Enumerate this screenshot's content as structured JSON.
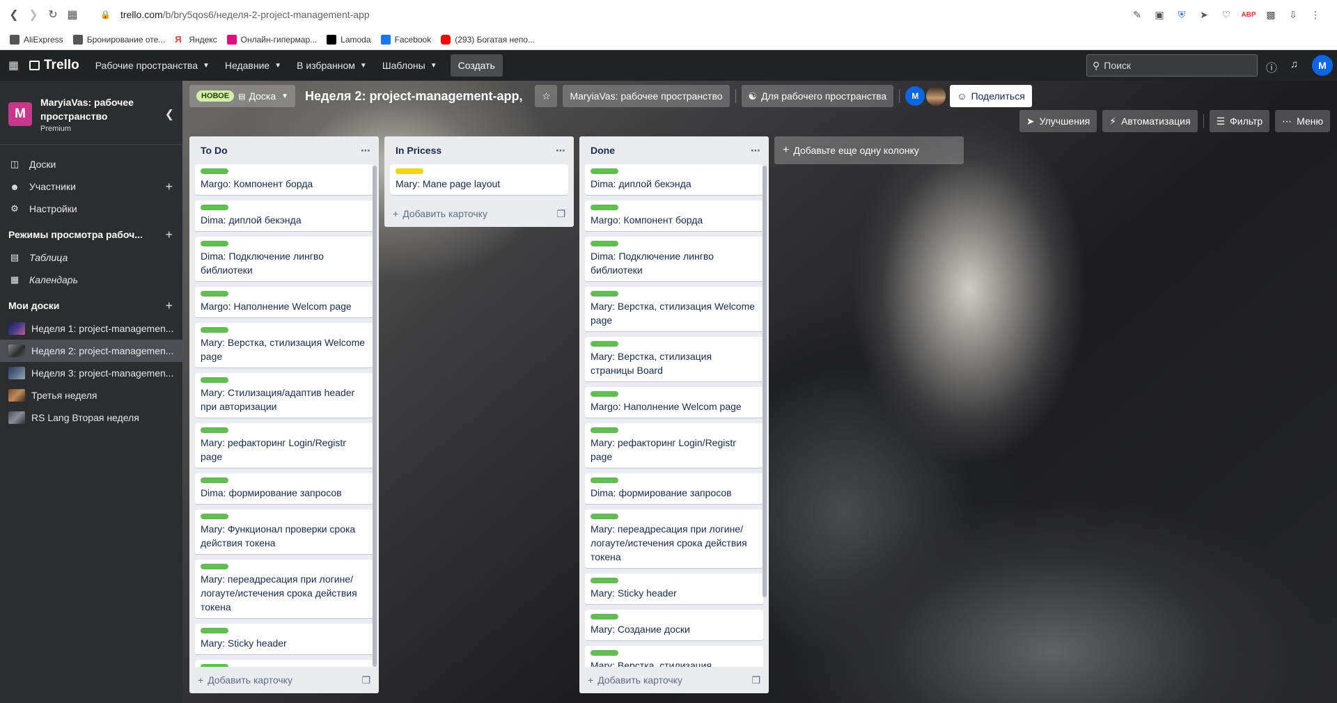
{
  "browser": {
    "url_domain": "trello.com",
    "url_path": "/b/bry5qos6/неделя-2-project-management-app",
    "bookmarks": [
      "AliExpress",
      "Бронирование оте...",
      "Яндекс",
      "Онлайн-гипермар...",
      "Lamoda",
      "Facebook",
      "(293) Богатая непо..."
    ]
  },
  "topnav": {
    "logo": "Trello",
    "menus": [
      "Рабочие пространства",
      "Недавние",
      "В избранном",
      "Шаблоны"
    ],
    "create": "Создать",
    "search_placeholder": "Поиск",
    "avatar": "M"
  },
  "sidebar": {
    "ws_initial": "M",
    "ws_name": "MaryiaVas: рабочее пространство",
    "ws_plan": "Premium",
    "items": [
      "Доски",
      "Участники",
      "Настройки"
    ],
    "views_header": "Режимы просмотра рабоч...",
    "views": [
      "Таблица",
      "Календарь"
    ],
    "boards_header": "Мои доски",
    "boards": [
      "Неделя 1: project-managemen...",
      "Неделя 2: project-managemen...",
      "Неделя 3: project-managemen...",
      "Третья неделя",
      "RS Lang Вторая неделя"
    ]
  },
  "board": {
    "new_badge": "НОВОЕ",
    "view": "Доска",
    "title": "Неделя 2: project-management-app,",
    "workspace": "MaryiaVas: рабочее пространство",
    "visibility": "Для рабочего пространства",
    "member": "M",
    "share": "Поделиться",
    "powerups": "Улучшения",
    "automation": "Автоматизация",
    "filter": "Фильтр",
    "menu": "Меню",
    "add_list": "Добавьте еще одну колонку",
    "add_card": "Добавить карточку"
  },
  "lists": [
    {
      "title": "To Do",
      "cards": [
        "Margo: Компонент борда",
        "Dima: диплой бекэнда",
        "Dima: Подключение лингво библиотеки",
        "Margo: Наполнение Welcom page",
        "Mary: Верстка, стилизация Welcome page",
        "Mary: Стилизация/адаптив header при авторизации",
        "Mary: рефакторинг Login/Registr page",
        "Dima: формирование запросов",
        "Mary: Функционал проверки срока действия токена",
        "Mary: переадресация при логине/логауте/истечения срока действия токена",
        "Mary: Sticky header"
      ]
    },
    {
      "title": "In Pricess",
      "cards": [
        "Mary: Mane page layout"
      ]
    },
    {
      "title": "Done",
      "cards": [
        "Dima: диплой бекэнда",
        "Margo: Компонент борда",
        "Dima: Подключение лингво библиотеки",
        "Mary: Верстка, стилизация Welcome page",
        "Mary: Верстка, стилизация страницы Board",
        "Margo: Наполнение Welcom page",
        "Mary: рефакторинг Login/Registr page",
        "Dima: формирование запросов",
        "Mary: переадресация при логине/логауте/истечения срока действия токена",
        "Mary: Sticky header",
        "Mary: Создание доски",
        "Mary: Верстка, стилизация"
      ]
    }
  ]
}
